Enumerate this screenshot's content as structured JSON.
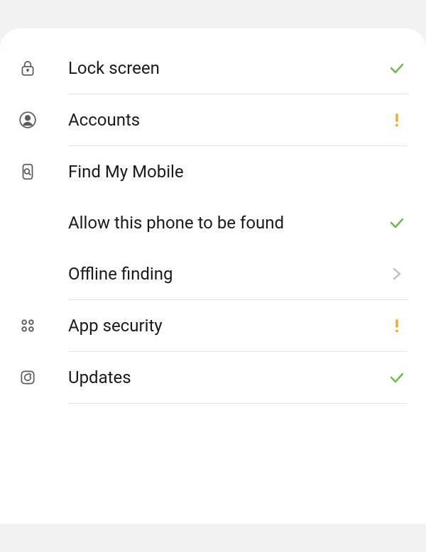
{
  "items": [
    {
      "id": "lock_screen",
      "label": "Lock screen",
      "status": "ok"
    },
    {
      "id": "accounts",
      "label": "Accounts",
      "status": "warning"
    },
    {
      "id": "find_my_mobile",
      "label": "Find My Mobile",
      "status": "none"
    },
    {
      "id": "allow_found",
      "label": "Allow this phone to be found",
      "status": "ok",
      "sub": true
    },
    {
      "id": "offline_finding",
      "label": "Offline finding",
      "status": "chevron",
      "sub": true
    },
    {
      "id": "app_security",
      "label": "App security",
      "status": "warning"
    },
    {
      "id": "updates",
      "label": "Updates",
      "status": "ok"
    }
  ],
  "colors": {
    "ok": "#6eb84f",
    "warning": "#f5a623",
    "chevron": "#bdbdbd",
    "icon": "#5c5c5c"
  }
}
